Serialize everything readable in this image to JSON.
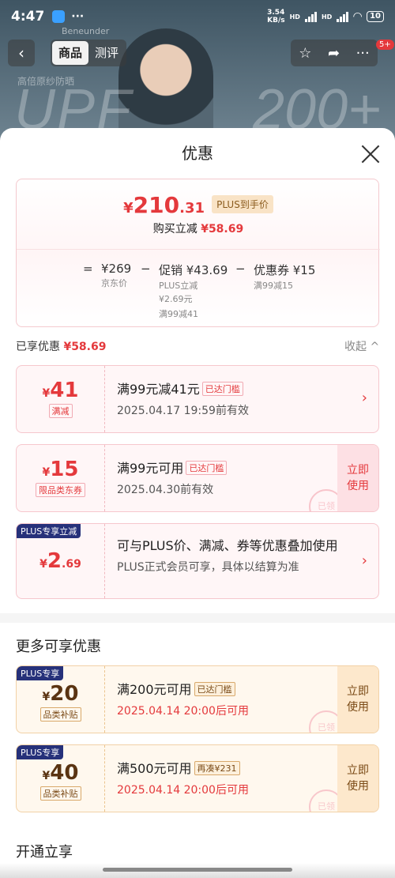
{
  "status_bar": {
    "time": "4:47",
    "dots": "···",
    "speed": "3.54\nKB/s",
    "hd1": "HD",
    "hd2": "HD",
    "battery": "10"
  },
  "background": {
    "brand": "Beneunder",
    "tagline": "高倍原纱防晒",
    "upf": "UPF",
    "upf_value": "200+"
  },
  "topbar": {
    "tabs": [
      "商品",
      "测评"
    ],
    "badge": "5+"
  },
  "sheet": {
    "title": "优惠",
    "price": {
      "currency": "¥",
      "integer": "210",
      "decimal": ".31",
      "plus_tag": "PLUS到手价",
      "reduce_label": "购买立减",
      "reduce_value": "¥58.69"
    },
    "formula": {
      "eq": "=",
      "base": {
        "value": "¥269",
        "label": "京东价"
      },
      "minus1": "−",
      "promo": {
        "value": "促销 ¥43.69",
        "sub1": "PLUS立减",
        "sub2": "¥2.69元",
        "sub3": "满99减41"
      },
      "minus2": "−",
      "coupon": {
        "value": "优惠券 ¥15",
        "sub1": "满99减15"
      }
    },
    "enjoyed": {
      "label": "已享优惠",
      "value": "¥58.69",
      "collapse": "收起 ^"
    },
    "cards": [
      {
        "y": "¥",
        "amount": "41",
        "tag": "满减",
        "title": "满99元减41元",
        "reached": "已达门槛",
        "desc": "2025.04.17 19:59前有效",
        "arrow": "›"
      },
      {
        "y": "¥",
        "amount": "15",
        "tag": "限品类东券",
        "title": "满99元可用",
        "reached": "已达门槛",
        "desc": "2025.04.30前有效",
        "use": "立即\n使用",
        "stamp": "已领"
      },
      {
        "corner": "PLUS专享立减",
        "y": "¥",
        "amount": "2",
        "dec": ".69",
        "title": "可与PLUS价、满减、券等优惠叠加使用",
        "desc": "PLUS正式会员可享，具体以结算为准",
        "arrow": "›"
      }
    ],
    "more_title": "更多可享优惠",
    "more_cards": [
      {
        "corner": "PLUS专享",
        "y": "¥",
        "amount": "20",
        "tag": "品类补贴",
        "title": "满200元可用",
        "reached": "已达门槛",
        "desc": "2025.04.14 20:00后可用",
        "use": "立即\n使用",
        "stamp": "已领"
      },
      {
        "corner": "PLUS专享",
        "y": "¥",
        "amount": "40",
        "tag": "品类补贴",
        "title": "满500元可用",
        "reached": "再凑¥231",
        "desc": "2025.04.14 20:00后可用",
        "use": "立即\n使用",
        "stamp": "已领"
      }
    ],
    "open_title": "开通立享"
  }
}
